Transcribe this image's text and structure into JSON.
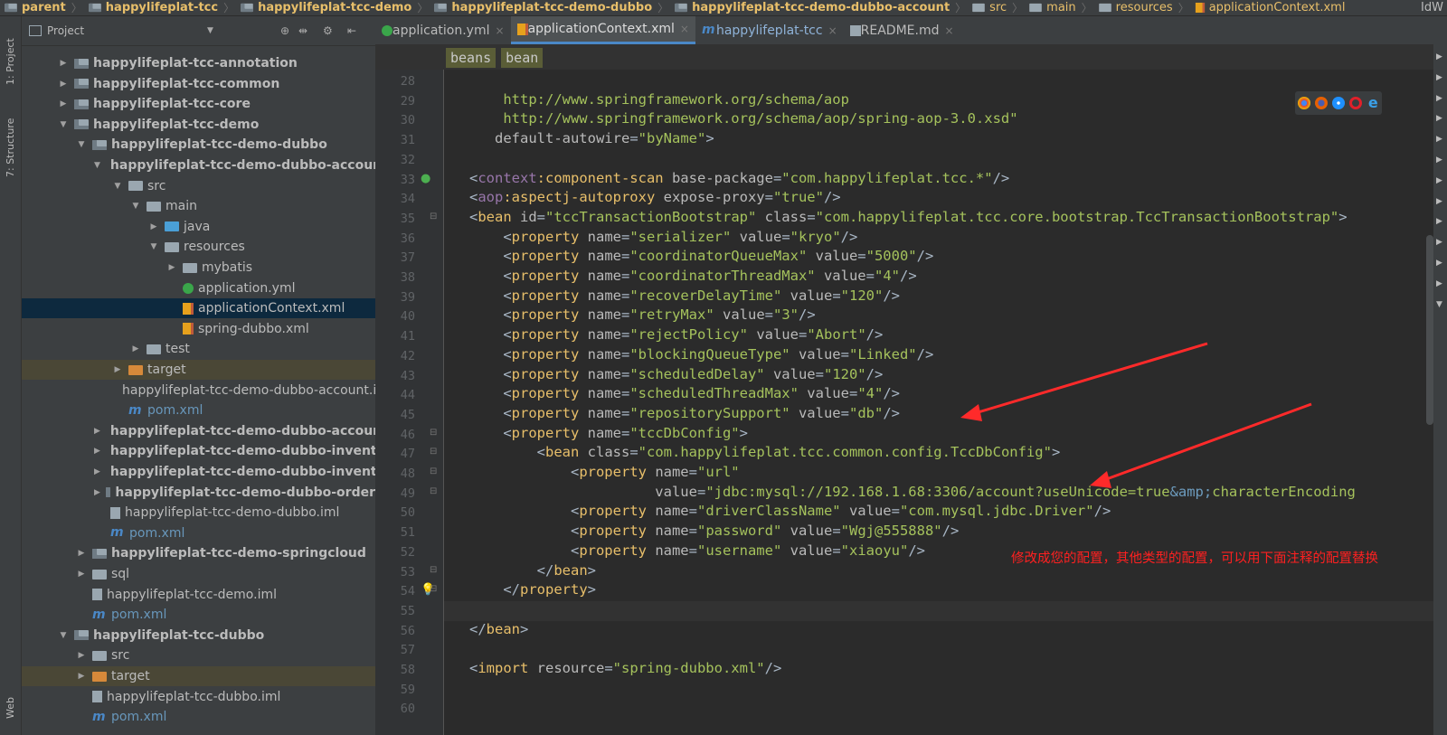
{
  "breadcrumb": [
    "parent",
    "happylifeplat-tcc",
    "happylifeplat-tcc-demo",
    "happylifeplat-tcc-demo-dubbo",
    "happylifeplat-tcc-demo-dubbo-account",
    "src",
    "main",
    "resources",
    "applicationContext.xml"
  ],
  "breadcrumb_right": "IdW",
  "left_strip": {
    "project": "1: Project",
    "structure": "7: Structure",
    "web": "Web"
  },
  "project_panel": {
    "title": "Project"
  },
  "tree": [
    {
      "label": "happylifeplat-tcc-annotation",
      "depth": 2,
      "arrow": "right",
      "icon": "module-folder-icon",
      "bold": true
    },
    {
      "label": "happylifeplat-tcc-common",
      "depth": 2,
      "arrow": "right",
      "icon": "module-folder-icon",
      "bold": true
    },
    {
      "label": "happylifeplat-tcc-core",
      "depth": 2,
      "arrow": "right",
      "icon": "module-folder-icon",
      "bold": true
    },
    {
      "label": "happylifeplat-tcc-demo",
      "depth": 2,
      "arrow": "down",
      "icon": "module-folder-icon",
      "bold": true
    },
    {
      "label": "happylifeplat-tcc-demo-dubbo",
      "depth": 3,
      "arrow": "down",
      "icon": "module-folder-icon",
      "bold": true
    },
    {
      "label": "happylifeplat-tcc-demo-dubbo-account",
      "depth": 4,
      "arrow": "down",
      "icon": "module-folder-icon",
      "bold": true
    },
    {
      "label": "src",
      "depth": 5,
      "arrow": "down",
      "icon": "folder-icon",
      "bold": false
    },
    {
      "label": "main",
      "depth": 6,
      "arrow": "down",
      "icon": "folder-icon",
      "bold": false
    },
    {
      "label": "java",
      "depth": 7,
      "arrow": "right",
      "icon": "source-folder-icon",
      "bold": false
    },
    {
      "label": "resources",
      "depth": 7,
      "arrow": "down",
      "icon": "resources-folder-icon",
      "bold": false
    },
    {
      "label": "mybatis",
      "depth": 8,
      "arrow": "right",
      "icon": "folder-icon",
      "bold": false
    },
    {
      "label": "application.yml",
      "depth": 8,
      "arrow": "",
      "icon": "yml-file-icon",
      "bold": false
    },
    {
      "label": "applicationContext.xml",
      "depth": 8,
      "arrow": "",
      "icon": "xml-file-icon",
      "bold": false,
      "selected": true
    },
    {
      "label": "spring-dubbo.xml",
      "depth": 8,
      "arrow": "",
      "icon": "xml-file-icon",
      "bold": false
    },
    {
      "label": "test",
      "depth": 6,
      "arrow": "right",
      "icon": "folder-icon",
      "bold": false
    },
    {
      "label": "target",
      "depth": 5,
      "arrow": "right",
      "icon": "excluded-folder-icon",
      "bold": false,
      "excluded": true
    },
    {
      "label": "happylifeplat-tcc-demo-dubbo-account.iml",
      "depth": 5,
      "arrow": "",
      "icon": "iml-file-icon",
      "bold": false
    },
    {
      "label": "pom.xml",
      "depth": 5,
      "arrow": "",
      "icon": "maven-icon",
      "bold": false
    },
    {
      "label": "happylifeplat-tcc-demo-dubbo-account-api",
      "depth": 4,
      "arrow": "right",
      "icon": "module-folder-icon",
      "bold": true
    },
    {
      "label": "happylifeplat-tcc-demo-dubbo-inventory",
      "depth": 4,
      "arrow": "right",
      "icon": "module-folder-icon",
      "bold": true
    },
    {
      "label": "happylifeplat-tcc-demo-dubbo-inventory-api",
      "depth": 4,
      "arrow": "right",
      "icon": "module-folder-icon",
      "bold": true
    },
    {
      "label": "happylifeplat-tcc-demo-dubbo-order",
      "depth": 4,
      "arrow": "right",
      "icon": "module-folder-icon",
      "bold": true
    },
    {
      "label": "happylifeplat-tcc-demo-dubbo.iml",
      "depth": 4,
      "arrow": "",
      "icon": "iml-file-icon",
      "bold": false
    },
    {
      "label": "pom.xml",
      "depth": 4,
      "arrow": "",
      "icon": "maven-icon",
      "bold": false
    },
    {
      "label": "happylifeplat-tcc-demo-springcloud",
      "depth": 3,
      "arrow": "right",
      "icon": "module-folder-icon",
      "bold": true
    },
    {
      "label": "sql",
      "depth": 3,
      "arrow": "right",
      "icon": "folder-icon",
      "bold": false
    },
    {
      "label": "happylifeplat-tcc-demo.iml",
      "depth": 3,
      "arrow": "",
      "icon": "iml-file-icon",
      "bold": false
    },
    {
      "label": "pom.xml",
      "depth": 3,
      "arrow": "",
      "icon": "maven-icon",
      "bold": false
    },
    {
      "label": "happylifeplat-tcc-dubbo",
      "depth": 2,
      "arrow": "down",
      "icon": "module-folder-icon",
      "bold": true
    },
    {
      "label": "src",
      "depth": 3,
      "arrow": "right",
      "icon": "folder-icon",
      "bold": false
    },
    {
      "label": "target",
      "depth": 3,
      "arrow": "right",
      "icon": "excluded-folder-icon",
      "bold": false,
      "excluded": true
    },
    {
      "label": "happylifeplat-tcc-dubbo.iml",
      "depth": 3,
      "arrow": "",
      "icon": "iml-file-icon",
      "bold": false
    },
    {
      "label": "pom.xml",
      "depth": 3,
      "arrow": "",
      "icon": "maven-icon",
      "bold": false
    }
  ],
  "tabs": [
    {
      "label": "application.yml",
      "icon": "yml-file-icon",
      "active": false
    },
    {
      "label": "applicationContext.xml",
      "icon": "xml-file-icon",
      "active": true
    },
    {
      "label": "happylifeplat-tcc",
      "icon": "maven-icon",
      "active": false
    },
    {
      "label": "README.md",
      "icon": "md-file-icon",
      "active": false
    }
  ],
  "xml_breadcrumb": [
    "beans",
    "bean"
  ],
  "code_lines": [
    {
      "n": "28",
      "parts": []
    },
    {
      "n": "29",
      "parts": [
        [
          "url",
          "       http://www.springframework.org/schema/aop"
        ]
      ]
    },
    {
      "n": "30",
      "parts": [
        [
          "url",
          "       http://www.springframework.org/schema/aop/spring-aop-3.0.xsd\""
        ]
      ]
    },
    {
      "n": "31",
      "parts": [
        [
          "a",
          "      default-autowire"
        ],
        [
          "p",
          "="
        ],
        [
          "v",
          "\"byName\""
        ],
        [
          "p",
          ">"
        ]
      ]
    },
    {
      "n": "32",
      "parts": []
    },
    {
      "n": "33",
      "parts": [
        [
          "p",
          "   <"
        ],
        [
          "ns",
          "context"
        ],
        [
          "t",
          ":component-scan "
        ],
        [
          "a",
          "base-package"
        ],
        [
          "p",
          "="
        ],
        [
          "v",
          "\"com.happylifeplat.tcc.*\""
        ],
        [
          "p",
          "/>"
        ]
      ]
    },
    {
      "n": "34",
      "parts": [
        [
          "p",
          "   <"
        ],
        [
          "ns",
          "aop"
        ],
        [
          "t",
          ":aspectj-autoproxy "
        ],
        [
          "a",
          "expose-proxy"
        ],
        [
          "p",
          "="
        ],
        [
          "v",
          "\"true\""
        ],
        [
          "p",
          "/>"
        ]
      ]
    },
    {
      "n": "35",
      "parts": [
        [
          "p",
          "   <"
        ],
        [
          "t",
          "bean "
        ],
        [
          "a",
          "id"
        ],
        [
          "p",
          "="
        ],
        [
          "v",
          "\"tccTransactionBootstrap\""
        ],
        [
          "a",
          " class"
        ],
        [
          "p",
          "="
        ],
        [
          "v",
          "\"com.happylifeplat.tcc.core.bootstrap.TccTransactionBootstrap\""
        ],
        [
          "p",
          ">"
        ]
      ]
    },
    {
      "n": "36",
      "parts": [
        [
          "p",
          "       <"
        ],
        [
          "t",
          "property "
        ],
        [
          "a",
          "name"
        ],
        [
          "p",
          "="
        ],
        [
          "v",
          "\"serializer\""
        ],
        [
          "a",
          " value"
        ],
        [
          "p",
          "="
        ],
        [
          "v",
          "\"kryo\""
        ],
        [
          "p",
          "/>"
        ]
      ]
    },
    {
      "n": "37",
      "parts": [
        [
          "p",
          "       <"
        ],
        [
          "t",
          "property "
        ],
        [
          "a",
          "name"
        ],
        [
          "p",
          "="
        ],
        [
          "v",
          "\"coordinatorQueueMax\""
        ],
        [
          "a",
          " value"
        ],
        [
          "p",
          "="
        ],
        [
          "v",
          "\"5000\""
        ],
        [
          "p",
          "/>"
        ]
      ]
    },
    {
      "n": "38",
      "parts": [
        [
          "p",
          "       <"
        ],
        [
          "t",
          "property "
        ],
        [
          "a",
          "name"
        ],
        [
          "p",
          "="
        ],
        [
          "v",
          "\"coordinatorThreadMax\""
        ],
        [
          "a",
          " value"
        ],
        [
          "p",
          "="
        ],
        [
          "v",
          "\"4\""
        ],
        [
          "p",
          "/>"
        ]
      ]
    },
    {
      "n": "39",
      "parts": [
        [
          "p",
          "       <"
        ],
        [
          "t",
          "property "
        ],
        [
          "a",
          "name"
        ],
        [
          "p",
          "="
        ],
        [
          "v",
          "\"recoverDelayTime\""
        ],
        [
          "a",
          " value"
        ],
        [
          "p",
          "="
        ],
        [
          "v",
          "\"120\""
        ],
        [
          "p",
          "/>"
        ]
      ]
    },
    {
      "n": "40",
      "parts": [
        [
          "p",
          "       <"
        ],
        [
          "t",
          "property "
        ],
        [
          "a",
          "name"
        ],
        [
          "p",
          "="
        ],
        [
          "v",
          "\"retryMax\""
        ],
        [
          "a",
          " value"
        ],
        [
          "p",
          "="
        ],
        [
          "v",
          "\"3\""
        ],
        [
          "p",
          "/>"
        ]
      ]
    },
    {
      "n": "41",
      "parts": [
        [
          "p",
          "       <"
        ],
        [
          "t",
          "property "
        ],
        [
          "a",
          "name"
        ],
        [
          "p",
          "="
        ],
        [
          "v",
          "\"rejectPolicy\""
        ],
        [
          "a",
          " value"
        ],
        [
          "p",
          "="
        ],
        [
          "v",
          "\"Abort\""
        ],
        [
          "p",
          "/>"
        ]
      ]
    },
    {
      "n": "42",
      "parts": [
        [
          "p",
          "       <"
        ],
        [
          "t",
          "property "
        ],
        [
          "a",
          "name"
        ],
        [
          "p",
          "="
        ],
        [
          "v",
          "\"blockingQueueType\""
        ],
        [
          "a",
          " value"
        ],
        [
          "p",
          "="
        ],
        [
          "v",
          "\"Linked\""
        ],
        [
          "p",
          "/>"
        ]
      ]
    },
    {
      "n": "43",
      "parts": [
        [
          "p",
          "       <"
        ],
        [
          "t",
          "property "
        ],
        [
          "a",
          "name"
        ],
        [
          "p",
          "="
        ],
        [
          "v",
          "\"scheduledDelay\""
        ],
        [
          "a",
          " value"
        ],
        [
          "p",
          "="
        ],
        [
          "v",
          "\"120\""
        ],
        [
          "p",
          "/>"
        ]
      ]
    },
    {
      "n": "44",
      "parts": [
        [
          "p",
          "       <"
        ],
        [
          "t",
          "property "
        ],
        [
          "a",
          "name"
        ],
        [
          "p",
          "="
        ],
        [
          "v",
          "\"scheduledThreadMax\""
        ],
        [
          "a",
          " value"
        ],
        [
          "p",
          "="
        ],
        [
          "v",
          "\"4\""
        ],
        [
          "p",
          "/>"
        ]
      ]
    },
    {
      "n": "45",
      "parts": [
        [
          "p",
          "       <"
        ],
        [
          "t",
          "property "
        ],
        [
          "a",
          "name"
        ],
        [
          "p",
          "="
        ],
        [
          "v",
          "\"repositorySupport\""
        ],
        [
          "a",
          " value"
        ],
        [
          "p",
          "="
        ],
        [
          "v",
          "\"db\""
        ],
        [
          "p",
          "/>"
        ]
      ]
    },
    {
      "n": "46",
      "parts": [
        [
          "p",
          "       <"
        ],
        [
          "t",
          "property "
        ],
        [
          "a",
          "name"
        ],
        [
          "p",
          "="
        ],
        [
          "v",
          "\"tccDbConfig\""
        ],
        [
          "p",
          ">"
        ]
      ]
    },
    {
      "n": "47",
      "parts": [
        [
          "p",
          "           <"
        ],
        [
          "t",
          "bean "
        ],
        [
          "a",
          "class"
        ],
        [
          "p",
          "="
        ],
        [
          "v",
          "\"com.happylifeplat.tcc.common.config.TccDbConfig\""
        ],
        [
          "p",
          ">"
        ]
      ]
    },
    {
      "n": "48",
      "parts": [
        [
          "p",
          "               <"
        ],
        [
          "t",
          "property "
        ],
        [
          "a",
          "name"
        ],
        [
          "p",
          "="
        ],
        [
          "v",
          "\"url\""
        ]
      ]
    },
    {
      "n": "49",
      "parts": [
        [
          "a",
          "                         value"
        ],
        [
          "p",
          "="
        ],
        [
          "v",
          "\"jdbc:mysql://192.168.1.68:3306/account?useUnicode=true"
        ],
        [
          "amp",
          "&amp;"
        ],
        [
          "v",
          "characterEncoding"
        ]
      ]
    },
    {
      "n": "50",
      "parts": [
        [
          "p",
          "               <"
        ],
        [
          "t",
          "property "
        ],
        [
          "a",
          "name"
        ],
        [
          "p",
          "="
        ],
        [
          "v",
          "\"driverClassName\""
        ],
        [
          "a",
          " value"
        ],
        [
          "p",
          "="
        ],
        [
          "v",
          "\"com.mysql.jdbc.Driver\""
        ],
        [
          "p",
          "/>"
        ]
      ]
    },
    {
      "n": "51",
      "parts": [
        [
          "p",
          "               <"
        ],
        [
          "t",
          "property "
        ],
        [
          "a",
          "name"
        ],
        [
          "p",
          "="
        ],
        [
          "v",
          "\"password\""
        ],
        [
          "a",
          " value"
        ],
        [
          "p",
          "="
        ],
        [
          "v",
          "\"Wgj@555888\""
        ],
        [
          "p",
          "/>"
        ]
      ]
    },
    {
      "n": "52",
      "parts": [
        [
          "p",
          "               <"
        ],
        [
          "t",
          "property "
        ],
        [
          "a",
          "name"
        ],
        [
          "p",
          "="
        ],
        [
          "v",
          "\"username\""
        ],
        [
          "a",
          " value"
        ],
        [
          "p",
          "="
        ],
        [
          "v",
          "\"xiaoyu\""
        ],
        [
          "p",
          "/>"
        ]
      ]
    },
    {
      "n": "53",
      "parts": [
        [
          "p",
          "           </"
        ],
        [
          "t",
          "bean"
        ],
        [
          "p",
          ">"
        ]
      ]
    },
    {
      "n": "54",
      "parts": [
        [
          "p",
          "       </"
        ],
        [
          "t",
          "property"
        ],
        [
          "p",
          ">"
        ]
      ]
    },
    {
      "n": "55",
      "parts": []
    },
    {
      "n": "56",
      "parts": [
        [
          "p",
          "   </"
        ],
        [
          "t",
          "bean"
        ],
        [
          "p",
          ">"
        ]
      ]
    },
    {
      "n": "57",
      "parts": []
    },
    {
      "n": "58",
      "parts": [
        [
          "p",
          "   <"
        ],
        [
          "t",
          "import "
        ],
        [
          "a",
          "resource"
        ],
        [
          "p",
          "="
        ],
        [
          "v",
          "\"spring-dubbo.xml\""
        ],
        [
          "p",
          "/>"
        ]
      ]
    },
    {
      "n": "59",
      "parts": []
    },
    {
      "n": "60",
      "parts": []
    }
  ],
  "annotation_note": "修改成您的配置，其他类型的配置，可以用下面注释的配置替换",
  "colors": {
    "arrow": "#ff2a2a",
    "selection": "#0d293e",
    "accent": "#4a88c7"
  }
}
